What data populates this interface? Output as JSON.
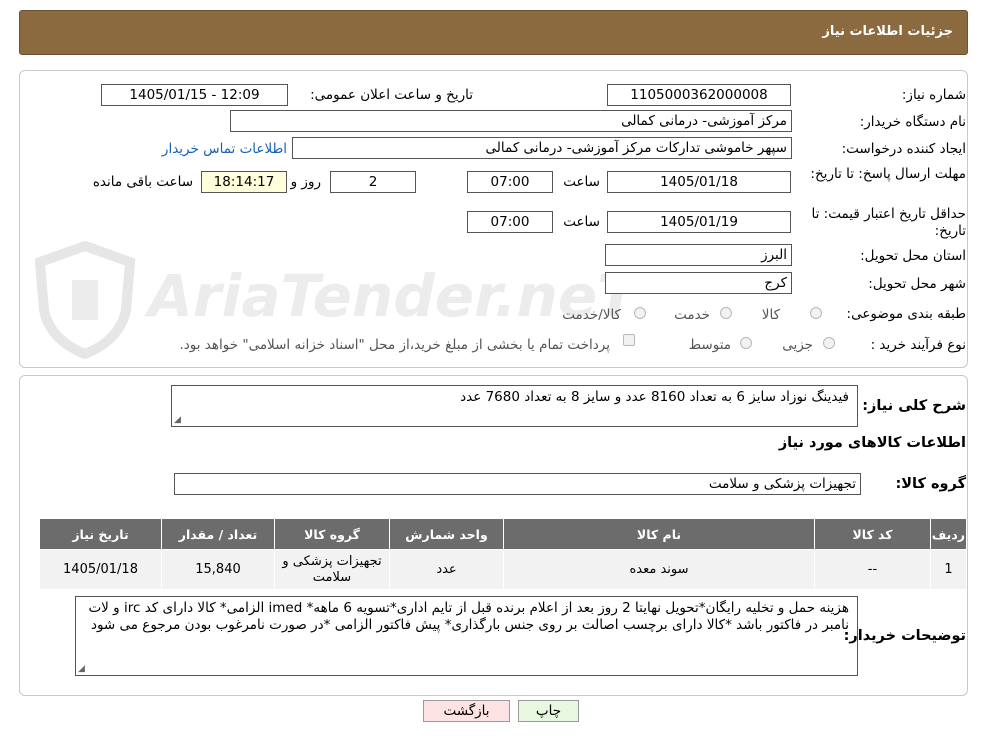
{
  "header": {
    "title": "جزئیات اطلاعات نیاز"
  },
  "watermark": {
    "text": "AriaTender.neT"
  },
  "form": {
    "need_number_label": "شماره نیاز:",
    "need_number": "1105000362000008",
    "announce_label": "تاریخ و ساعت اعلان عمومی:",
    "announce_value": "1405/01/15 - 12:09",
    "buyer_label": "نام دستگاه خریدار:",
    "buyer_value": "مرکز آموزشی- درمانی کمالی",
    "creator_label": "ایجاد کننده درخواست:",
    "creator_value": "سپهر خاموشی تدارکات مرکز آموزشی- درمانی کمالی",
    "contact_link": "اطلاعات تماس خریدار",
    "deadline_label": "مهلت ارسال پاسخ: تا تاریخ:",
    "deadline_date": "1405/01/18",
    "time_label": "ساعت",
    "deadline_time": "07:00",
    "days_value": "2",
    "days_label": "روز و",
    "remaining_time": "18:14:17",
    "remaining_label": "ساعت باقی مانده",
    "validity_label": "حداقل تاریخ اعتبار قیمت: تا تاریخ:",
    "validity_date": "1405/01/19",
    "validity_time": "07:00",
    "province_label": "استان محل تحویل:",
    "province_value": "البرز",
    "city_label": "شهر محل تحویل:",
    "city_value": "کرج",
    "category_label": "طبقه بندی موضوعی:",
    "category_options": [
      "کالا",
      "خدمت",
      "کالا/خدمت"
    ],
    "process_label": "نوع فرآیند خرید :",
    "process_options": [
      "جزیی",
      "متوسط"
    ],
    "payment_note": "پرداخت تمام یا بخشی از مبلغ خرید،از محل \"اسناد خزانه اسلامی\" خواهد بود."
  },
  "details": {
    "summary_label": "شرح کلی نیاز:",
    "summary_value": "فیدینگ نوزاد سایز 6 به تعداد 8160 عدد و سایز 8 به تعداد 7680 عدد",
    "items_heading": "اطلاعات کالاهای مورد نیاز",
    "group_label": "گروه کالا:",
    "group_value": "تجهیزات پزشکی و سلامت",
    "table": {
      "headers": [
        "ردیف",
        "کد کالا",
        "نام کالا",
        "واحد شمارش",
        "گروه کالا",
        "تعداد / مقدار",
        "تاریخ نیاز"
      ],
      "rows": [
        [
          "1",
          "--",
          "سوند معده",
          "عدد",
          "تجهیزات پزشکی و سلامت",
          "15,840",
          "1405/01/18"
        ]
      ]
    },
    "notes_label": "توضیحات خریدار:",
    "notes_value": "هزینه حمل و تخلیه رایگان*تحویل نهایتا 2 روز بعد از اعلام برنده قبل از تایم اداری*تسویه 6 ماهه* imed الزامی* کالا دارای کد irc و لات نامبر در فاکتور باشد *کالا دارای برچسب اصالت بر روی جنس بارگذاری* پیش فاکتور الزامی *در صورت نامرغوب بودن مرجوع می شود"
  },
  "buttons": {
    "print": "چاپ",
    "back": "بازگشت"
  },
  "colors": {
    "header_bg": "#8b6a3f",
    "table_header_bg": "#6c6c6c",
    "print_bg": "#e8f8e0",
    "back_bg": "#fde3e3"
  }
}
